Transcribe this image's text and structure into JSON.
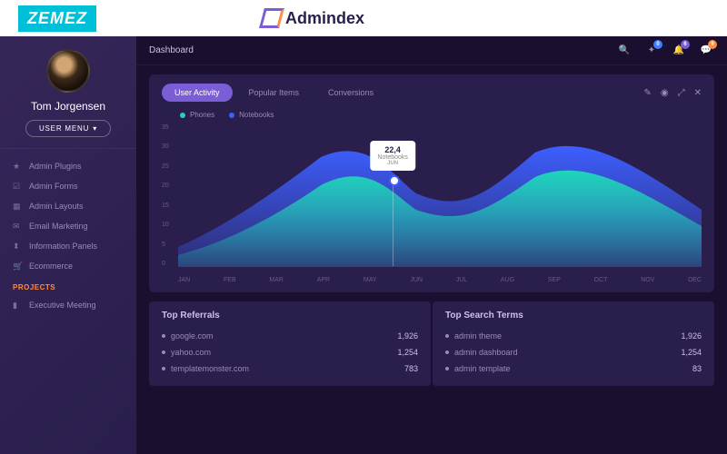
{
  "brand": {
    "zemez": "ZEMEZ",
    "product": "Admindex"
  },
  "user": {
    "name": "Tom Jorgensen",
    "menu_label": "USER MENU"
  },
  "nav": {
    "items": [
      {
        "icon": "★",
        "label": "Admin Plugins"
      },
      {
        "icon": "☑",
        "label": "Admin Forms"
      },
      {
        "icon": "▦",
        "label": "Admin Layouts"
      },
      {
        "icon": "✉",
        "label": "Email Marketing"
      },
      {
        "icon": "⬍",
        "label": "Information Panels"
      },
      {
        "icon": "🛒",
        "label": "Ecommerce"
      }
    ],
    "section": "PROJECTS",
    "projects": [
      {
        "icon": "▮",
        "label": "Executive Meeting"
      }
    ]
  },
  "topbar": {
    "title": "Dashboard",
    "badges": {
      "wand": "0",
      "bell": "6",
      "chat": "9"
    }
  },
  "tabs": [
    "User Activity",
    "Popular Items",
    "Conversions"
  ],
  "legend": [
    {
      "color": "teal",
      "label": "Phones"
    },
    {
      "color": "blue",
      "label": "Notebooks"
    }
  ],
  "tooltip": {
    "value": "22,4",
    "label": "Notebooks",
    "month": "JUN"
  },
  "chart_data": {
    "type": "area",
    "title": "User Activity",
    "xlabel": "",
    "ylabel": "",
    "ylim": [
      0,
      35
    ],
    "categories": [
      "JAN",
      "FEB",
      "MAR",
      "APR",
      "MAY",
      "JUN",
      "JUL",
      "AUG",
      "SEP",
      "OCT",
      "NOV",
      "DEC"
    ],
    "y_ticks": [
      35,
      30,
      25,
      20,
      15,
      10,
      5,
      0
    ],
    "series": [
      {
        "name": "Notebooks",
        "values": [
          5,
          10,
          18,
          27,
          32,
          22.4,
          13,
          18,
          28,
          33,
          26,
          14
        ]
      },
      {
        "name": "Phones",
        "values": [
          3,
          6,
          12,
          20,
          26,
          18,
          10,
          14,
          22,
          27,
          20,
          10
        ]
      }
    ]
  },
  "referrals": {
    "title": "Top Referrals",
    "rows": [
      {
        "label": "google.com",
        "value": "1,926"
      },
      {
        "label": "yahoo.com",
        "value": "1,254"
      },
      {
        "label": "templatemonster.com",
        "value": "783"
      }
    ]
  },
  "search_terms": {
    "title": "Top Search Terms",
    "rows": [
      {
        "label": "admin theme",
        "value": "1,926"
      },
      {
        "label": "admin dashboard",
        "value": "1,254"
      },
      {
        "label": "admin template",
        "value": "83"
      }
    ]
  }
}
